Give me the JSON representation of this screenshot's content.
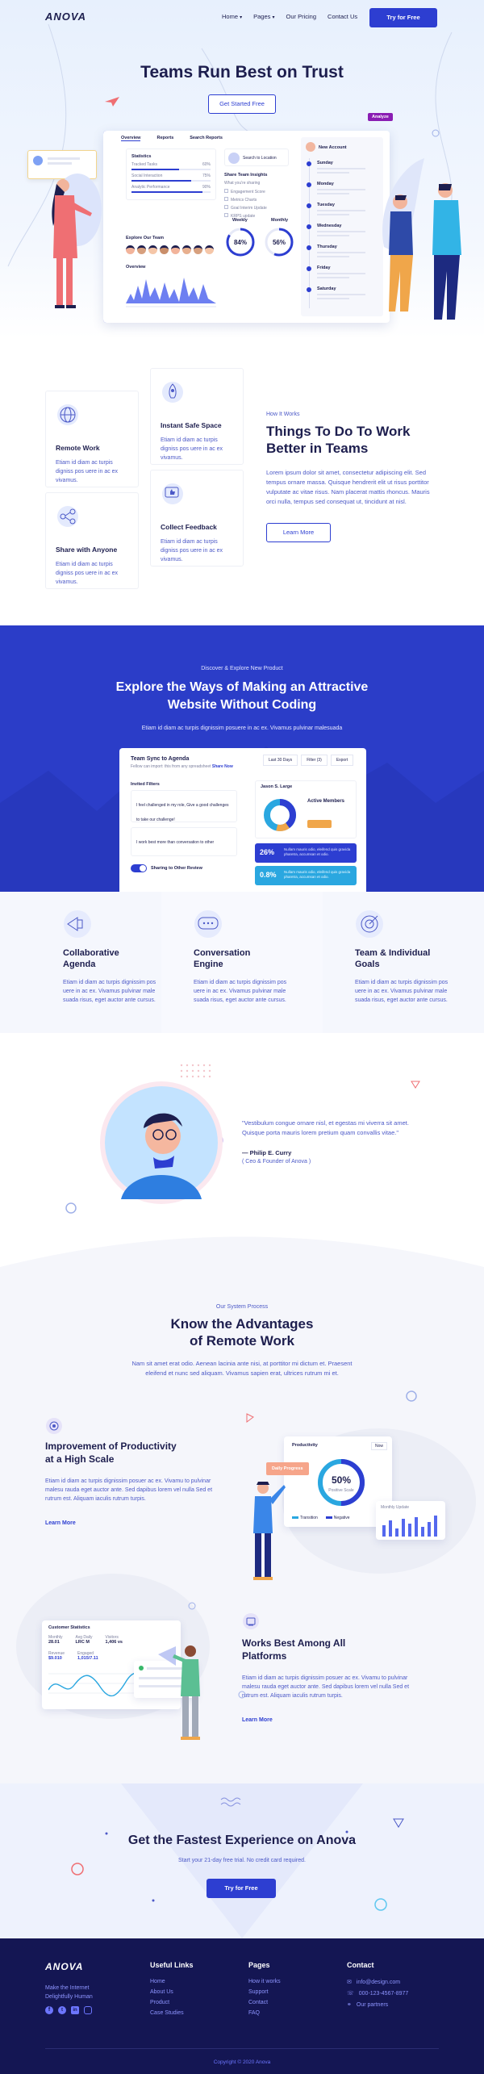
{
  "nav": {
    "logo": "ANOVA",
    "links": [
      "Home",
      "Pages",
      "Our Pricing",
      "Contact Us"
    ],
    "cta": "Try for Free"
  },
  "hero": {
    "title": "Teams Run Best on Trust",
    "cta": "Get Started Free",
    "badge": "Analyze",
    "dashboard": {
      "tabs": [
        "Overview",
        "Reports",
        "Search Reports"
      ],
      "widget_title": "Statistics",
      "progress": [
        {
          "label": "Tracked Tasks",
          "value": "60%",
          "level": 0.6
        },
        {
          "label": "Social Interaction",
          "value": "75%",
          "level": 0.75
        },
        {
          "label": "Analytic Performance",
          "value": "90%",
          "level": 0.9
        }
      ],
      "explore_title": "Explore Our Team",
      "overview_label": "Overview",
      "share_title": "Share Team Insights",
      "share_sub": "What you're sharing",
      "share_items": [
        "Engagement Score",
        "Metrics Charts",
        "Goal Interim Update",
        "KRPS update"
      ],
      "weekly_label": "Weekly",
      "monthly_label": "Monthly",
      "weekly_pct": "84%",
      "monthly_pct": "56%",
      "weekly_level": 0.84,
      "monthly_level": 0.56,
      "search_label": "Search to Location",
      "new_account": "New Account",
      "days": [
        "Sunday",
        "Monday",
        "Tuesday",
        "Wednesday",
        "Thursday",
        "Friday",
        "Saturday"
      ]
    }
  },
  "how": {
    "cards": [
      {
        "title": "Remote Work",
        "text": "Etiam id diam ac turpis digniss pos uere in ac ex vivamus.",
        "icon": "globe-icon"
      },
      {
        "title": "Instant Safe Space",
        "text": "Etiam id diam ac turpis digniss pos uere in ac ex vivamus.",
        "icon": "rocket-icon"
      },
      {
        "title": "Share with Anyone",
        "text": "Etiam id diam ac turpis digniss pos uere in ac ex vivamus.",
        "icon": "share-icon"
      },
      {
        "title": "Collect Feedback",
        "text": "Etiam id diam ac turpis digniss pos uere in ac ex vivamus.",
        "icon": "thumbs-up-icon"
      }
    ],
    "eyebrow": "How It Works",
    "title_line1": "Things To Do To Work",
    "title_line2": "Better in Teams",
    "body": "Lorem ipsum dolor sit amet, consectetur adipiscing elit. Sed tempus ornare massa. Quisque hendrerit elit ut risus porttitor vulputate ac vitae risus. Nam placerat mattis rhoncus. Mauris orci nulla, tempus sed consequat ut, tincidunt at nisl.",
    "cta": "Learn More"
  },
  "explore": {
    "eyebrow": "Discover & Explore New Product",
    "title_line1": "Explore the Ways of Making an Attractive",
    "title_line2": "Website Without Coding",
    "sub": "Etiam id diam ac turpis dignissim posuere in ac ex. Vivamus pulvinar malesuada",
    "app": {
      "title": "Team Sync to Agenda",
      "sub": "Fellow can import: this from any spreadsheet",
      "link": "Share Now",
      "filters": [
        "Last 30 Days",
        "Filter (3)",
        "Export"
      ],
      "invited": "Invited Filters",
      "notes": [
        "I feel challenged in my role, Give a good challenges to take our challenge!",
        "I work best more than conversation to other"
      ],
      "toggle": "Sharing to Other Review",
      "member": "Jason S. Large",
      "active_members": "Active Members",
      "stat1": "26%",
      "stat2": "0.8%",
      "stat_text": "Nullam mauris odio, eleifend quis gravida pharetra, accumsan et odio."
    }
  },
  "features": [
    {
      "title_line1": "Collaborative",
      "title_line2": "Agenda",
      "text": "Etiam id diam ac turpis dignissim pos uere in ac ex. Vivamus pulvinar male suada risus, eget auctor ante cursus.",
      "icon": "megaphone-icon"
    },
    {
      "title_line1": "Conversation",
      "title_line2": "Engine",
      "text": "Etiam id diam ac turpis dignissim pos uere in ac ex. Vivamus pulvinar male suada risus, eget auctor ante cursus.",
      "icon": "chat-bubble-icon"
    },
    {
      "title_line1": "Team & Individual",
      "title_line2": "Goals",
      "text": "Etiam id diam ac turpis dignissim pos uere in ac ex. Vivamus pulvinar male suada risus, eget auctor ante cursus.",
      "icon": "target-icon"
    }
  ],
  "testimonial": {
    "quote": "\"Vestibulum congue ornare nisl, et egestas mi viverra sit amet. Quisque porta mauris lorem pretium quam convallis vitae.\"",
    "name": "— Philip E. Curry",
    "role": "( Ceo & Founder of Anova )"
  },
  "advantages": {
    "eyebrow": "Our System Process",
    "title_line1": "Know the Advantages",
    "title_line2": "of Remote Work",
    "sub": "Nam sit amet erat odio. Aenean lacinia ante nisi, at porttitor mi dictum et. Praesent eleifend et nunc sed aliquam. Vivamus sapien erat, ultrices rutrum mi et.",
    "block1": {
      "title_line1": "Improvement of Productivity",
      "title_line2": "at a High Scale",
      "text": "Etiam id diam ac turpis dignissim posuer ac ex. Vivamu to pulvinar malesu rauda eget auctor ante. Sed dapibus lorem vel nulla Sed et rutrum est. Aliquam iaculis rutrum turpis.",
      "cta": "Learn More",
      "card_title": "Productivity",
      "card_select": "Now",
      "tag": "Daily Progress",
      "pct": "50%",
      "pct_label": "Positive Scale",
      "pct_level": 0.5,
      "legend": [
        "Transition",
        "Negative"
      ],
      "mini_label": "Monthly Update"
    },
    "block2": {
      "title_line1": "Works Best Among All",
      "title_line2": "Platforms",
      "text": "Etiam id diam ac turpis dignissim posuer ac ex. Vivamu to pulvinar malesu rauda eget auctor ante. Sed dapibus lorem vel nulla Sed et rutrum est. Aliquam iaculis rutrum turpis.",
      "cta": "Learn More",
      "card_title": "Customer Statistics",
      "stats": [
        {
          "label": "Monthly",
          "value": "28.01"
        },
        {
          "label": "Avg Daily",
          "value": "LRC M"
        },
        {
          "label": "Visitors",
          "value": "1,406 vs"
        }
      ],
      "stats2": [
        {
          "label": "Revenue",
          "value": "$9.010"
        },
        {
          "label": "Engaged",
          "value": "1,015/7.11"
        }
      ]
    }
  },
  "cta": {
    "title": "Get the Fastest Experience on Anova",
    "sub": "Start your 21-day free trial. No credit card required.",
    "button": "Try for Free"
  },
  "footer": {
    "logo": "ANOVA",
    "tagline_line1": "Make the Internet",
    "tagline_line2": "Delightfully Human",
    "social": [
      "facebook-icon",
      "twitter-icon",
      "linkedin-icon",
      "instagram-icon"
    ],
    "useful_title": "Useful Links",
    "useful": [
      "Home",
      "About Us",
      "Product",
      "Case Studies"
    ],
    "pages_title": "Pages",
    "pages": [
      "How it works",
      "Support",
      "Contact",
      "FAQ"
    ],
    "contact_title": "Contact",
    "contact": [
      "info@design.com",
      "000-123-4567-8977",
      "Our partners"
    ],
    "copyright": "Copyright © 2020 Anova"
  },
  "colors": {
    "primary": "#2d3ed1",
    "dark": "#1d1e4e",
    "accent_text": "#4c59c7",
    "footer_bg": "#141653"
  }
}
